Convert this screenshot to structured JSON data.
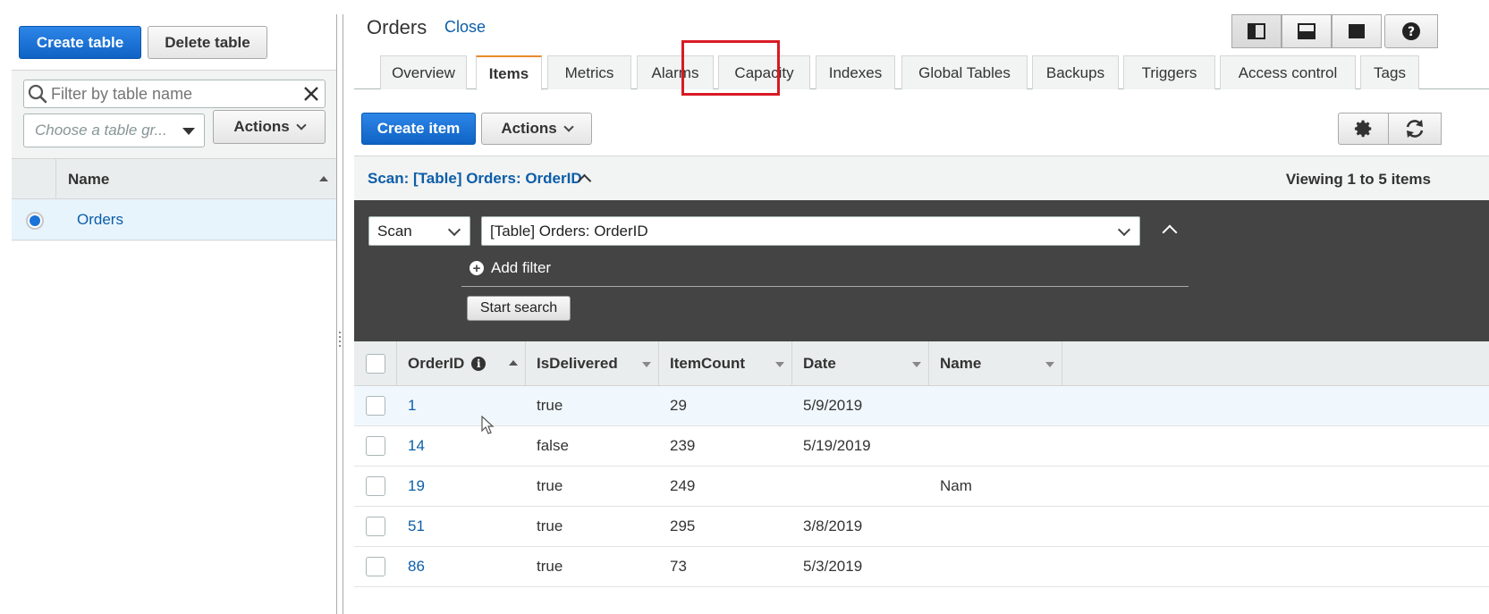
{
  "left": {
    "create_table": "Create table",
    "delete_table": "Delete table",
    "filter_placeholder": "Filter by table name",
    "group_placeholder": "Choose a table gr...",
    "actions": "Actions",
    "name_header": "Name",
    "tables": [
      {
        "name": "Orders",
        "selected": true
      }
    ]
  },
  "header": {
    "title": "Orders",
    "close": "Close"
  },
  "tabs": [
    "Overview",
    "Items",
    "Metrics",
    "Alarms",
    "Capacity",
    "Indexes",
    "Global Tables",
    "Backups",
    "Triggers",
    "Access control",
    "Tags"
  ],
  "active_tab": "Items",
  "highlighted_tab": "Capacity",
  "toolbar": {
    "create_item": "Create item",
    "actions": "Actions"
  },
  "scan": {
    "title": "Scan: [Table] Orders: OrderID",
    "viewing": "Viewing 1 to 5 items",
    "mode": "Scan",
    "target": "[Table] Orders: OrderID",
    "add_filter": "Add filter",
    "start_search": "Start search"
  },
  "grid": {
    "columns": [
      "OrderID",
      "IsDelivered",
      "ItemCount",
      "Date",
      "Name"
    ],
    "rows": [
      [
        "1",
        "true",
        "29",
        "5/9/2019",
        ""
      ],
      [
        "14",
        "false",
        "239",
        "5/19/2019",
        ""
      ],
      [
        "19",
        "true",
        "249",
        "",
        "Nam"
      ],
      [
        "51",
        "true",
        "295",
        "3/8/2019",
        ""
      ],
      [
        "86",
        "true",
        "73",
        "5/3/2019",
        ""
      ]
    ]
  },
  "colors": {
    "primary": "#1a73d9",
    "link": "#0c5ea8",
    "active_tab_accent": "#e88b2d",
    "highlight": "#d91a26",
    "query_panel": "#444444"
  }
}
